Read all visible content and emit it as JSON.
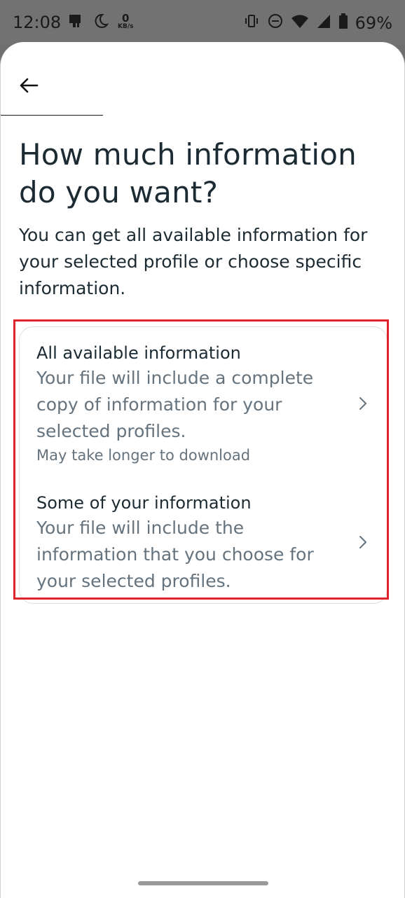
{
  "status_bar": {
    "time": "12:08",
    "network_speed_value": "0",
    "network_speed_unit": "KB/s",
    "battery": "69%"
  },
  "header": {
    "back_icon": "arrow-left-icon"
  },
  "page": {
    "title": "How much information do you want?",
    "subtitle": "You can get all available information for your selected profile or choose specific information."
  },
  "options": [
    {
      "title": "All available information",
      "description": "Your file will include a complete copy of information for your selected profiles.",
      "note": "May take longer to download",
      "icon": "chevron-right-icon"
    },
    {
      "title": "Some of your information",
      "description": "Your file will include the information that you choose for your selected profiles.",
      "icon": "chevron-right-icon"
    }
  ],
  "colors": {
    "highlight": "#e0242c",
    "primary_text": "#1c2b33",
    "secondary_text": "#65737e"
  }
}
